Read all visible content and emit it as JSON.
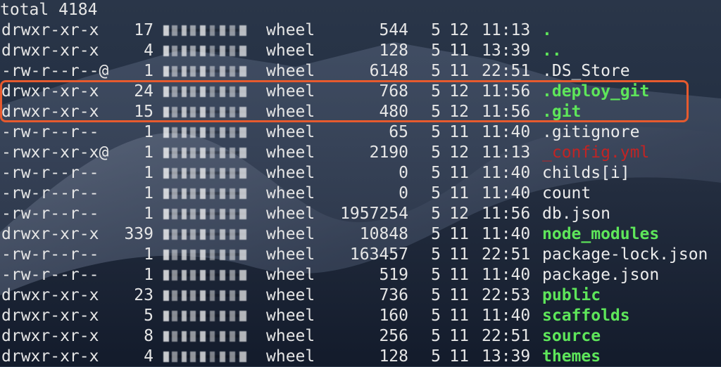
{
  "terminal": {
    "total_line": "total 4184",
    "highlight_color": "#e65a2e",
    "rows": [
      {
        "perm": "drwxr-xr-x",
        "links": "17",
        "group": "wheel",
        "size": "544",
        "month": "5",
        "day": "12",
        "time": "11:13",
        "name": ".",
        "type": "dir"
      },
      {
        "perm": "drwxr-xr-x",
        "links": "4",
        "group": "wheel",
        "size": "128",
        "month": "5",
        "day": "11",
        "time": "13:39",
        "name": "..",
        "type": "dir"
      },
      {
        "perm": "-rw-r--r--@",
        "links": "1",
        "group": "wheel",
        "size": "6148",
        "month": "5",
        "day": "11",
        "time": "22:51",
        "name": ".DS_Store",
        "type": "plain"
      },
      {
        "perm": "drwxr-xr-x",
        "links": "24",
        "group": "wheel",
        "size": "768",
        "month": "5",
        "day": "12",
        "time": "11:56",
        "name": ".deploy_git",
        "type": "dir"
      },
      {
        "perm": "drwxr-xr-x",
        "links": "15",
        "group": "wheel",
        "size": "480",
        "month": "5",
        "day": "12",
        "time": "11:56",
        "name": ".git",
        "type": "dir"
      },
      {
        "perm": "-rw-r--r--",
        "links": "1",
        "group": "wheel",
        "size": "65",
        "month": "5",
        "day": "11",
        "time": "11:40",
        "name": ".gitignore",
        "type": "plain"
      },
      {
        "perm": "-rwxr-xr-x@",
        "links": "1",
        "group": "wheel",
        "size": "2190",
        "month": "5",
        "day": "12",
        "time": "11:13",
        "name": "_config.yml",
        "type": "exec"
      },
      {
        "perm": "-rw-r--r--",
        "links": "1",
        "group": "wheel",
        "size": "0",
        "month": "5",
        "day": "11",
        "time": "11:40",
        "name": "childs[i]",
        "type": "plain"
      },
      {
        "perm": "-rw-r--r--",
        "links": "1",
        "group": "wheel",
        "size": "0",
        "month": "5",
        "day": "11",
        "time": "11:40",
        "name": "count",
        "type": "plain"
      },
      {
        "perm": "-rw-r--r--",
        "links": "1",
        "group": "wheel",
        "size": "1957254",
        "month": "5",
        "day": "12",
        "time": "11:56",
        "name": "db.json",
        "type": "plain"
      },
      {
        "perm": "drwxr-xr-x",
        "links": "339",
        "group": "wheel",
        "size": "10848",
        "month": "5",
        "day": "11",
        "time": "11:40",
        "name": "node_modules",
        "type": "dir"
      },
      {
        "perm": "-rw-r--r--",
        "links": "1",
        "group": "wheel",
        "size": "163457",
        "month": "5",
        "day": "11",
        "time": "22:51",
        "name": "package-lock.json",
        "type": "plain"
      },
      {
        "perm": "-rw-r--r--",
        "links": "1",
        "group": "wheel",
        "size": "519",
        "month": "5",
        "day": "11",
        "time": "11:40",
        "name": "package.json",
        "type": "plain"
      },
      {
        "perm": "drwxr-xr-x",
        "links": "23",
        "group": "wheel",
        "size": "736",
        "month": "5",
        "day": "11",
        "time": "22:53",
        "name": "public",
        "type": "dir"
      },
      {
        "perm": "drwxr-xr-x",
        "links": "5",
        "group": "wheel",
        "size": "160",
        "month": "5",
        "day": "11",
        "time": "11:40",
        "name": "scaffolds",
        "type": "dir"
      },
      {
        "perm": "drwxr-xr-x",
        "links": "8",
        "group": "wheel",
        "size": "256",
        "month": "5",
        "day": "11",
        "time": "22:51",
        "name": "source",
        "type": "dir"
      },
      {
        "perm": "drwxr-xr-x",
        "links": "4",
        "group": "wheel",
        "size": "128",
        "month": "5",
        "day": "11",
        "time": "13:39",
        "name": "themes",
        "type": "dir"
      }
    ]
  }
}
